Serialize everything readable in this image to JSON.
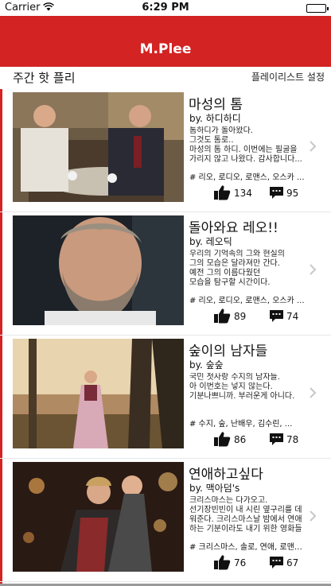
{
  "status_bar": {
    "carrier": "Carrier",
    "time": "6:29 PM"
  },
  "nav": {
    "title": "M.Plee"
  },
  "section": {
    "title": "주간 핫 플리",
    "settings_label": "플레이리스트 설정"
  },
  "playlists": [
    {
      "title": "마성의 톰",
      "author": "by. 하디하디",
      "description": "톰하디가 돌아왔다.\n그것도 톰로..\n마성의 톰 하디. 이번에는 필굴을\n가리지 않고 나왔다. 감사합니다...",
      "tags": "# 리오, 로디오, 로맨스, 오스카 ...",
      "likes": "134",
      "comments": "95",
      "image_icon": "men-at-table-photo"
    },
    {
      "title": "돌아와요 레오!!",
      "author": "by. 레오딕",
      "description": "우리의 기억속의 그와 현실의\n그의 모습은 달라져만 간다.\n예전 그의 이름다웠던\n모습을 탐구할 시간이다.",
      "tags": "# 리오, 로디오, 로맨스, 오스카 ...",
      "likes": "89",
      "comments": "74",
      "image_icon": "bearded-man-portrait"
    },
    {
      "title": "숲이의 남자들",
      "author": "by. 숲숲",
      "description": "국민 첫사랑 수지의 남자들.\n아 이번호는 넣지 않는다.\n기분나쁘니까. 부러운게 아니다.",
      "tags": "# 수지, 숲, 난배우, 김수린, ...",
      "likes": "86",
      "comments": "78",
      "image_icon": "woman-in-forest-photo"
    },
    {
      "title": "연애하고싶다",
      "author": "by. 맥아덤's",
      "description": "크리스마스는 다가오고.\n선기장빈빈이 내 시린 옆구리를 데\n워준다. 크리스마스날 밤에서 연애\n하는 기분이라도 내기 위한 영화들",
      "tags": "# 크리스마스, 솔로, 연애, 로맨스, ...",
      "likes": "76",
      "comments": "67",
      "image_icon": "couple-embrace-photo"
    }
  ]
}
